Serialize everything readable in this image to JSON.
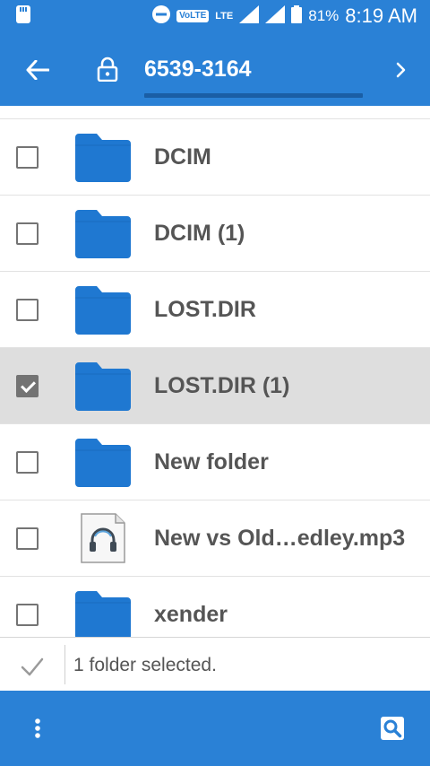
{
  "status_bar": {
    "volte": "VoLTE",
    "lte": "LTE",
    "battery": "81%",
    "time": "8:19 AM"
  },
  "toolbar": {
    "title": "6539-3164"
  },
  "files": [
    {
      "name": "DCIM",
      "type": "folder",
      "checked": false
    },
    {
      "name": "DCIM (1)",
      "type": "folder",
      "checked": false
    },
    {
      "name": "LOST.DIR",
      "type": "folder",
      "checked": false
    },
    {
      "name": "LOST.DIR (1)",
      "type": "folder",
      "checked": true
    },
    {
      "name": "New folder",
      "type": "folder",
      "checked": false
    },
    {
      "name": "New vs Old…edley.mp3",
      "type": "audio",
      "checked": false
    },
    {
      "name": "xender",
      "type": "folder",
      "checked": false
    }
  ],
  "selection": {
    "text": "1 folder selected."
  },
  "colors": {
    "primary": "#2a81d6",
    "folder": "#1f78d1",
    "selected_row": "#dedede"
  }
}
